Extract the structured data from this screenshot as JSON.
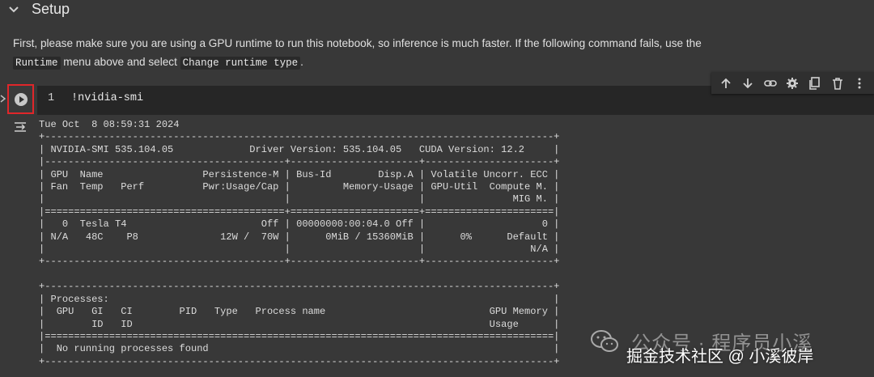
{
  "section": {
    "title": "Setup"
  },
  "description": {
    "line1": "First, please make sure you are using a GPU runtime to run this notebook, so inference is much faster. If the following command fails, use the",
    "runtime_chip": "Runtime",
    "middle": " menu above and select ",
    "change_chip": "Change runtime type",
    "end": "."
  },
  "cell": {
    "line_number": "1",
    "code": "!nvidia-smi"
  },
  "toolbar": {
    "icons": [
      "arrow-up-icon",
      "arrow-down-icon",
      "link-icon",
      "gear-icon",
      "mirror-cell-icon",
      "delete-icon",
      "more-vert-icon"
    ]
  },
  "output": {
    "text": "Tue Oct  8 08:59:31 2024       \n+---------------------------------------------------------------------------------------+\n| NVIDIA-SMI 535.104.05             Driver Version: 535.104.05   CUDA Version: 12.2     |\n|-----------------------------------------+----------------------+----------------------+\n| GPU  Name                 Persistence-M | Bus-Id        Disp.A | Volatile Uncorr. ECC |\n| Fan  Temp   Perf          Pwr:Usage/Cap |         Memory-Usage | GPU-Util  Compute M. |\n|                                         |                      |               MIG M. |\n|=========================================+======================+======================|\n|   0  Tesla T4                       Off | 00000000:00:04.0 Off |                    0 |\n| N/A   48C    P8              12W /  70W |      0MiB / 15360MiB |      0%      Default |\n|                                         |                      |                  N/A |\n+-----------------------------------------+----------------------+----------------------+\n                                                                                         \n+---------------------------------------------------------------------------------------+\n| Processes:                                                                            |\n|  GPU   GI   CI        PID   Type   Process name                            GPU Memory |\n|        ID   ID                                                             Usage      |\n|=======================================================================================|\n|  No running processes found                                                           |\n+---------------------------------------------------------------------------------------+"
  },
  "watermark": {
    "line1": "公众号 · 程序员小溪",
    "line2": "掘金技术社区 @ 小溪彼岸"
  },
  "colors": {
    "background": "#383838",
    "cell_background": "#262626",
    "run_highlight": "#e0262a",
    "text": "#e3e3e3"
  }
}
